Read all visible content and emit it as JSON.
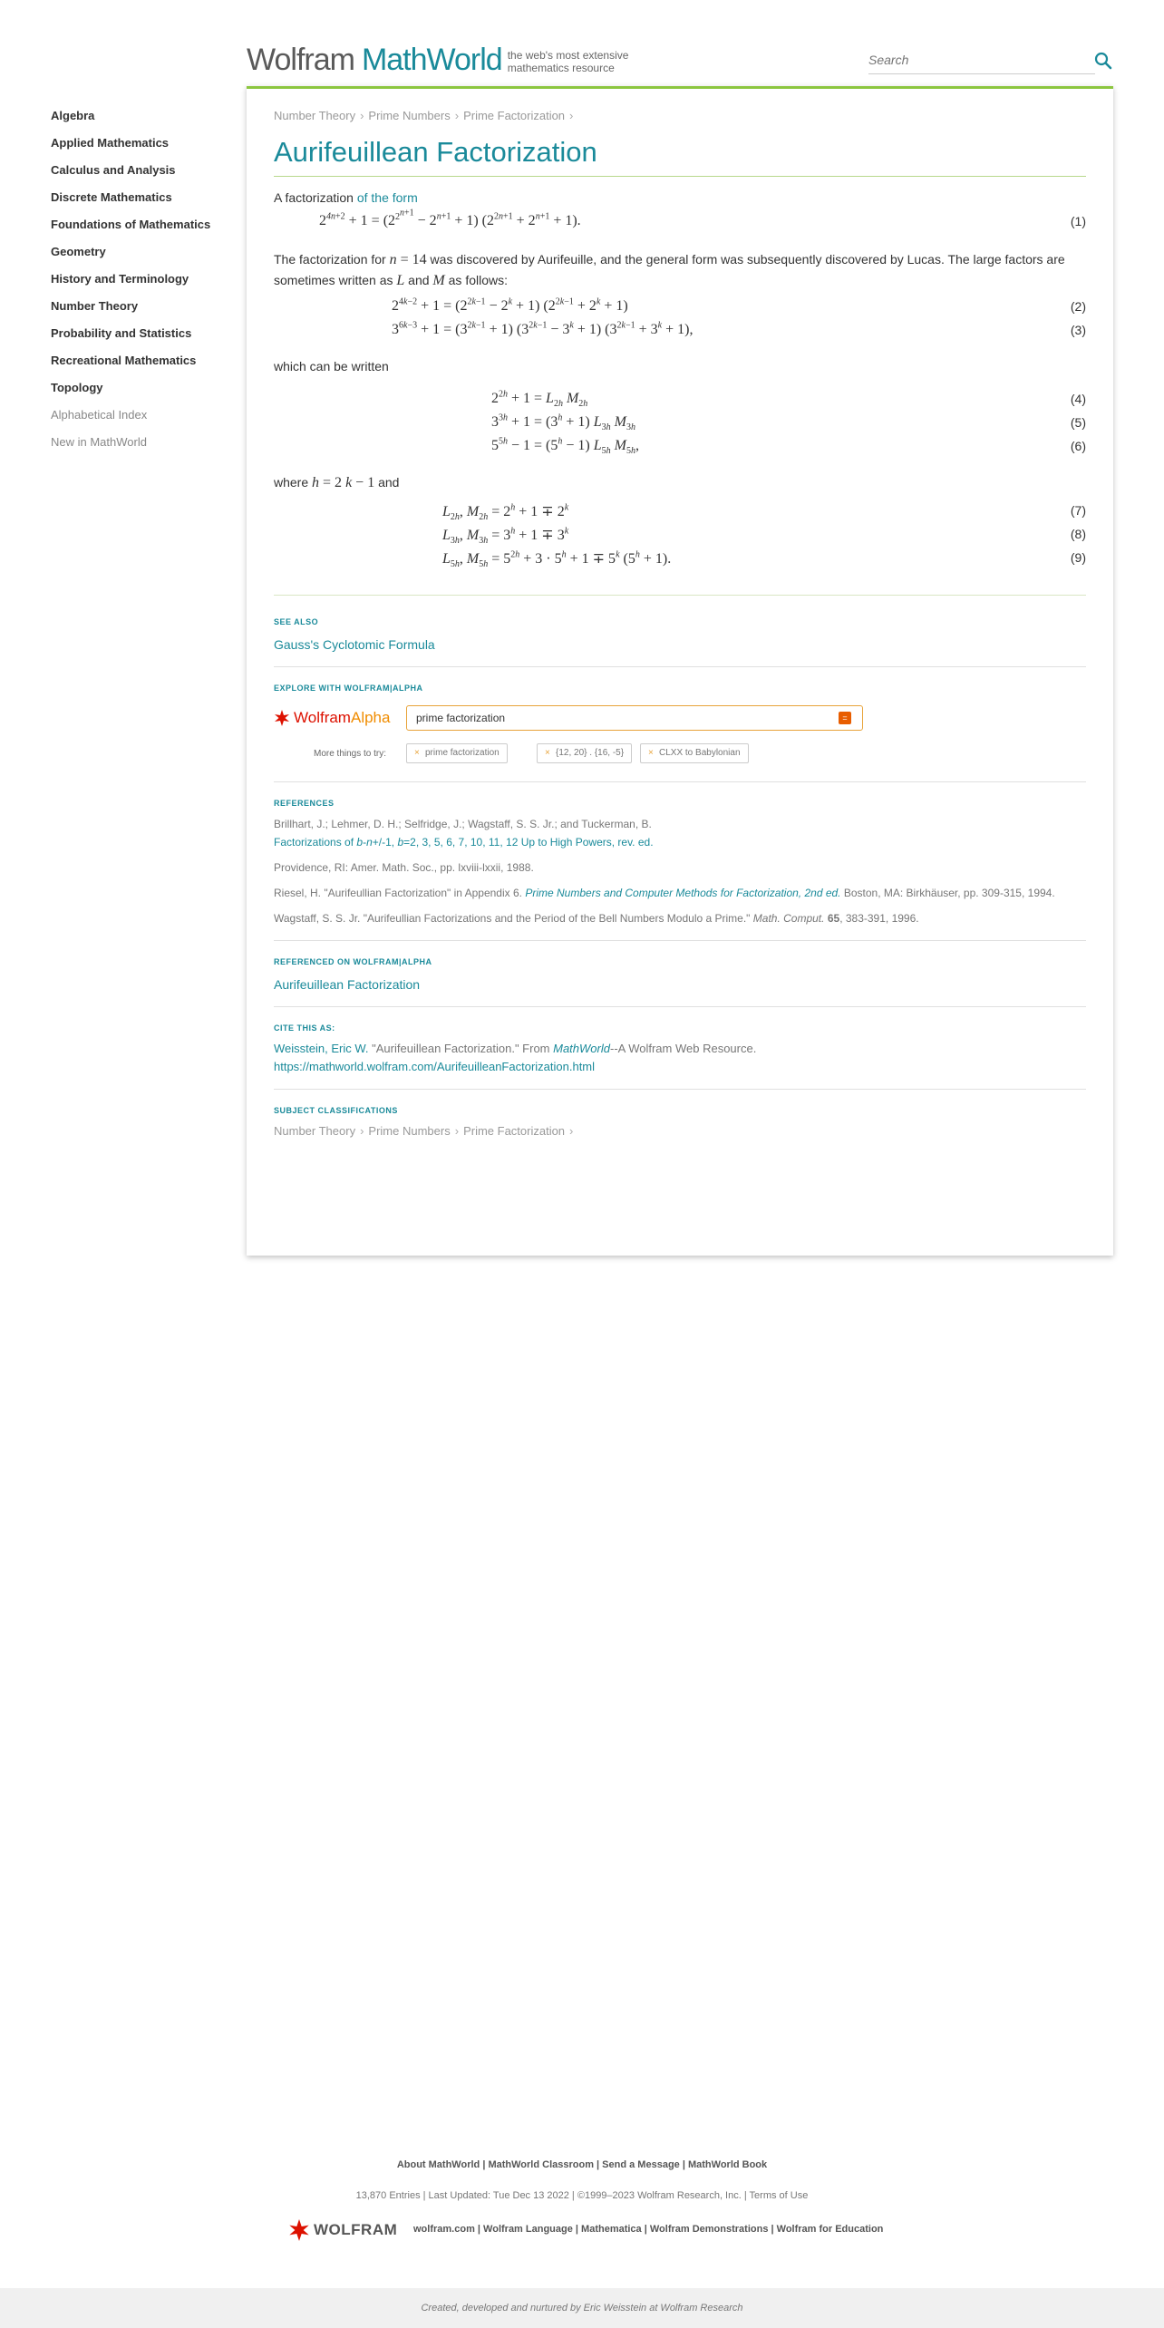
{
  "header": {
    "logo_wolfram": "Wolfram",
    "logo_mathworld": "MathWorld",
    "logo_tagline": "the web's most extensive mathematics resource",
    "search_placeholder": "Search",
    "search_icon": "magnifier-icon"
  },
  "sidebar": {
    "items": [
      {
        "label": "Algebra"
      },
      {
        "label": "Applied Mathematics"
      },
      {
        "label": "Calculus and Analysis"
      },
      {
        "label": "Discrete Mathematics"
      },
      {
        "label": "Foundations of Mathematics"
      },
      {
        "label": "Geometry"
      },
      {
        "label": "History and Terminology"
      },
      {
        "label": "Number Theory"
      },
      {
        "label": "Probability and Statistics"
      },
      {
        "label": "Recreational Mathematics"
      },
      {
        "label": "Topology"
      },
      {
        "label": "Alphabetical Index"
      },
      {
        "label": "New in MathWorld"
      }
    ]
  },
  "breadcrumb": [
    "Number Theory",
    "Prime Numbers",
    "Prime Factorization"
  ],
  "breadcrumb_sep": "›",
  "title": "Aurifeuillean Factorization",
  "intro": {
    "text": "A factorization",
    "link": "of the form"
  },
  "para2": {
    "t1": "The factorization for",
    "t2": "was discovered by Aurifeuille, and the general form was subsequently discovered by Lucas. The large factors are sometimes written as",
    "t3": "and",
    "t4": "as follows:"
  },
  "para3": "which can be written",
  "para4": {
    "t1": "where",
    "t2": "and"
  },
  "equation_numbers": [
    "(1)",
    "(2)",
    "(3)",
    "(4)",
    "(5)",
    "(6)",
    "(7)",
    "(8)",
    "(9)"
  ],
  "see_also": {
    "heading": "See also",
    "link": "Gauss's Cyclotomic Formula"
  },
  "explore": {
    "heading": "Explore with Wolfram|Alpha",
    "logo_wolfram": "Wolfram",
    "logo_alpha": "Alpha",
    "input_value": "prime factorization",
    "go_label": "=",
    "more_label": "More things to try:",
    "chips": [
      "prime factorization",
      "{12, 20} . {16, -5}",
      "CLXX to Babylonian"
    ]
  },
  "references": {
    "heading": "References",
    "r1_authors": "Brillhart, J.; Lehmer, D. H.; Selfridge, J.; Wagstaff, S. S. Jr.; and Tuckerman, B.",
    "r1_title_a": "Factorizations of",
    "r1_title_b": "b",
    "r1_title_c": "-",
    "r1_title_d": "n",
    "r1_title_e": "+/-1,",
    "r1_title_f": "b",
    "r1_title_g": "=2, 3, 5, 6, 7, 10, 11, 12 Up to High Powers, rev. ed.",
    "r1_pub": "Providence, RI: Amer. Math. Soc., pp. lxviii-lxxii, 1988.",
    "r2_a": "Riesel, H. \"Aurifeullian Factorization\" in Appendix 6.",
    "r2_link": "Prime Numbers and Computer Methods for Factorization, 2nd ed.",
    "r2_b": "Boston, MA: Birkhäuser, pp. 309-315, 1994.",
    "r3_a": "Wagstaff, S. S. Jr. \"Aurifeullian Factorizations and the Period of the Bell Numbers Modulo a Prime.\"",
    "r3_journal": "Math. Comput.",
    "r3_vol": "65",
    "r3_b": ", 383-391, 1996."
  },
  "referenced_on": {
    "heading": "Referenced on Wolfram|Alpha",
    "link": "Aurifeuillean Factorization"
  },
  "cite": {
    "heading": "Cite this as:",
    "author": "Weisstein, Eric W.",
    "text_a": "\"Aurifeuillean Factorization.\" From",
    "mathworld": "MathWorld",
    "text_b": "--A Wolfram Web Resource.",
    "url": "https://mathworld.wolfram.com/AurifeuilleanFactorization.html"
  },
  "subject": {
    "heading": "Subject classifications",
    "items": [
      "Number Theory",
      "Prime Numbers",
      "Prime Factorization"
    ]
  },
  "footer": {
    "links": "About MathWorld | MathWorld Classroom | Send a Message | MathWorld Book",
    "meta": "13,870 Entries | Last Updated: Tue Dec 13 2022 | ©1999–2023 Wolfram Research, Inc. | Terms of Use",
    "brand": "WOLFRAM",
    "brand_links": "wolfram.com | Wolfram Language | Mathematica | Wolfram Demonstrations | Wolfram for Education",
    "credit": "Created, developed and nurtured by Eric Weisstein at Wolfram Research"
  },
  "colors": {
    "accent": "#1a8a9a",
    "green_rule": "#8cc63f",
    "alpha_orange": "#e85d00"
  }
}
